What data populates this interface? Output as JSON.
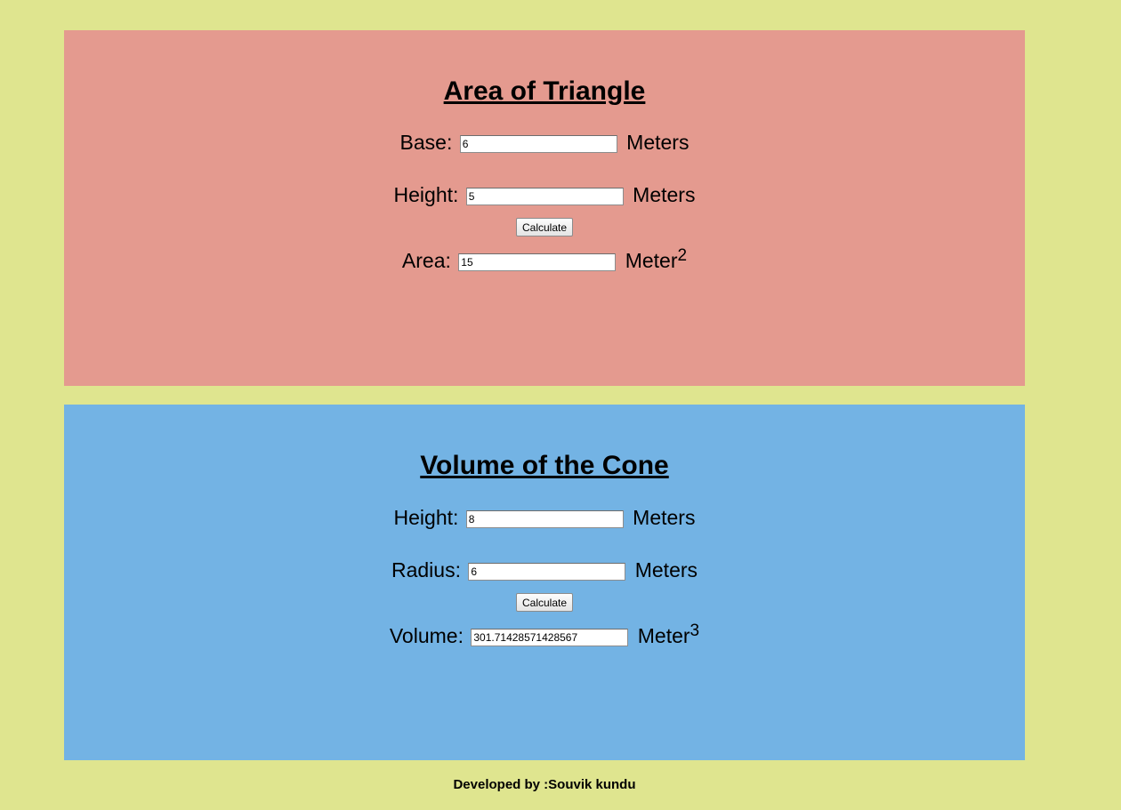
{
  "triangle": {
    "title": "Area of Triangle",
    "base_label": "Base:",
    "base_value": "6",
    "base_unit": "Meters",
    "height_label": "Height:",
    "height_value": "5",
    "height_unit": "Meters",
    "button_label": "Calculate",
    "area_label": "Area:",
    "area_value": "15",
    "area_unit": "Meter",
    "area_exponent": "2"
  },
  "cone": {
    "title": "Volume of the Cone",
    "height_label": "Height:",
    "height_value": "8",
    "height_unit": "Meters",
    "radius_label": "Radius:",
    "radius_value": "6",
    "radius_unit": "Meters",
    "button_label": "Calculate",
    "volume_label": "Volume:",
    "volume_value": "301.71428571428567",
    "volume_unit": "Meter",
    "volume_exponent": "3"
  },
  "footer": {
    "text": "Developed by :Souvik kundu"
  },
  "colors": {
    "page_background": "#dfe58f",
    "triangle_panel": "#e49a8f",
    "cone_panel": "#73b3e4"
  }
}
